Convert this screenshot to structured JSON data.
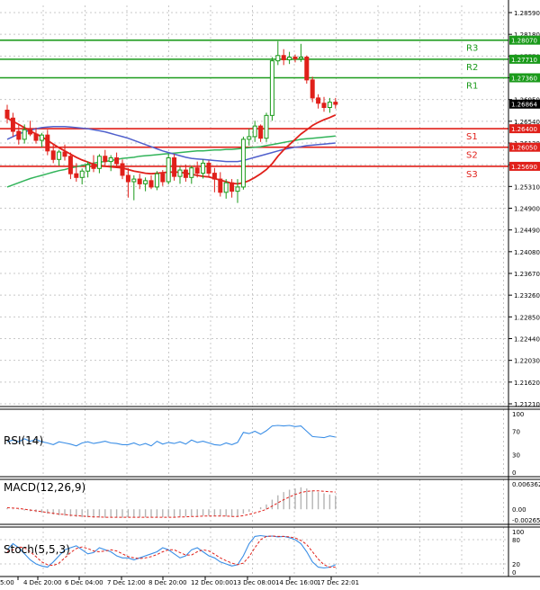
{
  "chart_data": {
    "type": "candlestick",
    "main": {
      "ylim": [
        1.19,
        1.2928
      ],
      "y_ticks": [
        "1.28590",
        "1.28180",
        "1.27770",
        "1.27360",
        "1.26950",
        "1.26540",
        "1.26130",
        "1.25720",
        "1.25310",
        "1.24900",
        "1.24490",
        "1.24080",
        "1.23670",
        "1.23260",
        "1.22850",
        "1.22440",
        "1.22030",
        "1.21620",
        "1.21210"
      ],
      "current_price": "1.26864",
      "levels": [
        {
          "name": "R3",
          "value": 1.2807,
          "label": "1.28070",
          "color": "#1a9a1a"
        },
        {
          "name": "R2",
          "value": 1.2771,
          "label": "1.27710",
          "color": "#1a9a1a"
        },
        {
          "name": "R1",
          "value": 1.2736,
          "label": "1.27360",
          "color": "#1a9a1a"
        },
        {
          "name": "S1",
          "value": 1.264,
          "label": "1.26400",
          "color": "#e0201a"
        },
        {
          "name": "S2",
          "value": 1.2605,
          "label": "1.26050",
          "color": "#e0201a"
        },
        {
          "name": "S3",
          "value": 1.2569,
          "label": "1.25690",
          "color": "#e0201a"
        }
      ],
      "candles": [
        [
          1.2675,
          1.2685,
          1.265,
          1.266
        ],
        [
          1.266,
          1.267,
          1.2625,
          1.2635
        ],
        [
          1.2635,
          1.2648,
          1.261,
          1.262
        ],
        [
          1.262,
          1.2648,
          1.2612,
          1.2638
        ],
        [
          1.2638,
          1.2655,
          1.2626,
          1.263
        ],
        [
          1.263,
          1.2642,
          1.2612,
          1.2618
        ],
        [
          1.2618,
          1.2632,
          1.2605,
          1.2628
        ],
        [
          1.2628,
          1.2638,
          1.259,
          1.2598
        ],
        [
          1.2598,
          1.2612,
          1.2575,
          1.2582
        ],
        [
          1.2582,
          1.26,
          1.257,
          1.2596
        ],
        [
          1.2596,
          1.261,
          1.258,
          1.2588
        ],
        [
          1.2588,
          1.2595,
          1.2545,
          1.2555
        ],
        [
          1.2555,
          1.2575,
          1.254,
          1.2548
        ],
        [
          1.2548,
          1.2565,
          1.2535,
          1.256
        ],
        [
          1.256,
          1.2578,
          1.2548,
          1.2572
        ],
        [
          1.2572,
          1.259,
          1.2558,
          1.2565
        ],
        [
          1.2565,
          1.2592,
          1.2556,
          1.2588
        ],
        [
          1.2588,
          1.26,
          1.257,
          1.2578
        ],
        [
          1.2578,
          1.259,
          1.256,
          1.2585
        ],
        [
          1.2585,
          1.2595,
          1.2566,
          1.2574
        ],
        [
          1.2574,
          1.2582,
          1.2545,
          1.2552
        ],
        [
          1.2552,
          1.2566,
          1.251,
          1.254
        ],
        [
          1.254,
          1.2552,
          1.2505,
          1.2545
        ],
        [
          1.2545,
          1.2555,
          1.2526,
          1.2536
        ],
        [
          1.2536,
          1.2548,
          1.2522,
          1.2542
        ],
        [
          1.2542,
          1.2552,
          1.2526,
          1.253
        ],
        [
          1.253,
          1.256,
          1.2524,
          1.2555
        ],
        [
          1.2555,
          1.2562,
          1.2532,
          1.254
        ],
        [
          1.254,
          1.2592,
          1.2535,
          1.2585
        ],
        [
          1.2585,
          1.2592,
          1.2542,
          1.255
        ],
        [
          1.255,
          1.2568,
          1.2536,
          1.2562
        ],
        [
          1.2562,
          1.2572,
          1.254,
          1.2548
        ],
        [
          1.2548,
          1.257,
          1.2536,
          1.2566
        ],
        [
          1.2566,
          1.2578,
          1.2548,
          1.2556
        ],
        [
          1.2556,
          1.2582,
          1.2546,
          1.2575
        ],
        [
          1.2575,
          1.258,
          1.255,
          1.2556
        ],
        [
          1.2556,
          1.2566,
          1.252,
          1.2545
        ],
        [
          1.2545,
          1.2558,
          1.2512,
          1.252
        ],
        [
          1.252,
          1.2545,
          1.2508,
          1.2538
        ],
        [
          1.2538,
          1.2545,
          1.251,
          1.2522
        ],
        [
          1.2522,
          1.2545,
          1.25,
          1.253
        ],
        [
          1.253,
          1.2625,
          1.2525,
          1.262
        ],
        [
          1.262,
          1.264,
          1.2608,
          1.2625
        ],
        [
          1.2625,
          1.2655,
          1.2615,
          1.2645
        ],
        [
          1.2645,
          1.2648,
          1.2615,
          1.2622
        ],
        [
          1.2622,
          1.267,
          1.2615,
          1.2665
        ],
        [
          1.2665,
          1.2775,
          1.2655,
          1.2768
        ],
        [
          1.2768,
          1.2805,
          1.276,
          1.2778
        ],
        [
          1.2778,
          1.279,
          1.276,
          1.277
        ],
        [
          1.277,
          1.2785,
          1.2762,
          1.2775
        ],
        [
          1.2775,
          1.278,
          1.2765,
          1.2772
        ],
        [
          1.2772,
          1.28,
          1.2766,
          1.2775
        ],
        [
          1.2775,
          1.2778,
          1.2725,
          1.2732
        ],
        [
          1.2732,
          1.2738,
          1.269,
          1.2698
        ],
        [
          1.2698,
          1.2705,
          1.2678,
          1.2688
        ],
        [
          1.2688,
          1.27,
          1.2672,
          1.268
        ],
        [
          1.268,
          1.2698,
          1.267,
          1.269
        ],
        [
          1.269,
          1.2698,
          1.2678,
          1.2686
        ]
      ],
      "ma_fast": [
        1.266,
        1.2654,
        1.2648,
        1.2642,
        1.2636,
        1.263,
        1.2625,
        1.2618,
        1.2611,
        1.2604,
        1.2598,
        1.2592,
        1.2586,
        1.2581,
        1.2577,
        1.2573,
        1.2571,
        1.2569,
        1.2568,
        1.2567,
        1.2566,
        1.2563,
        1.256,
        1.2558,
        1.2556,
        1.2555,
        1.2556,
        1.2557,
        1.2558,
        1.2558,
        1.2558,
        1.2556,
        1.2554,
        1.2552,
        1.255,
        1.2549,
        1.2546,
        1.2543,
        1.254,
        1.2537,
        1.2536,
        1.2538,
        1.2542,
        1.2548,
        1.2555,
        1.2563,
        1.2574,
        1.2588,
        1.26,
        1.261,
        1.262,
        1.263,
        1.2638,
        1.2646,
        1.2652,
        1.2657,
        1.2661,
        1.2666
      ],
      "ma_mid": [
        1.262,
        1.2625,
        1.263,
        1.2634,
        1.2637,
        1.264,
        1.2642,
        1.2643,
        1.2644,
        1.2644,
        1.2644,
        1.2643,
        1.2642,
        1.2641,
        1.264,
        1.2638,
        1.2636,
        1.2634,
        1.2631,
        1.2628,
        1.2625,
        1.2622,
        1.2618,
        1.2614,
        1.261,
        1.2606,
        1.2602,
        1.2598,
        1.2595,
        1.2592,
        1.2589,
        1.2586,
        1.2584,
        1.2583,
        1.2582,
        1.2581,
        1.258,
        1.2579,
        1.2578,
        1.2578,
        1.2578,
        1.258,
        1.2583,
        1.2586,
        1.2589,
        1.2592,
        1.2595,
        1.2598,
        1.2601,
        1.2603,
        1.2605,
        1.2606,
        1.2608,
        1.2609,
        1.261,
        1.2611,
        1.2612,
        1.2613
      ],
      "ma_slow": [
        1.253,
        1.2534,
        1.2538,
        1.2542,
        1.2546,
        1.2549,
        1.2552,
        1.2555,
        1.2558,
        1.2561,
        1.2563,
        1.2566,
        1.2568,
        1.2571,
        1.2573,
        1.2575,
        1.2577,
        1.2578,
        1.258,
        1.2582,
        1.2584,
        1.2585,
        1.2586,
        1.2588,
        1.2589,
        1.259,
        1.2591,
        1.2592,
        1.2593,
        1.2594,
        1.2595,
        1.2596,
        1.2597,
        1.2598,
        1.2598,
        1.2599,
        1.26,
        1.26,
        1.2601,
        1.2601,
        1.2602,
        1.2603,
        1.2604,
        1.2605,
        1.2606,
        1.2608,
        1.261,
        1.2612,
        1.2614,
        1.2616,
        1.2618,
        1.262,
        1.2621,
        1.2622,
        1.2623,
        1.2624,
        1.2625,
        1.2626
      ]
    },
    "rsi": {
      "title": "RSI(14)",
      "ticks": [
        "100",
        "70",
        "30",
        "0"
      ],
      "values": [
        52,
        55,
        52,
        57,
        53,
        56,
        52,
        50,
        47,
        52,
        50,
        48,
        45,
        50,
        52,
        49,
        51,
        53,
        50,
        49,
        47,
        47,
        50,
        46,
        49,
        45,
        53,
        48,
        51,
        49,
        52,
        48,
        55,
        51,
        53,
        50,
        47,
        46,
        50,
        47,
        51,
        68,
        66,
        70,
        65,
        71,
        79,
        80,
        79,
        80,
        78,
        79,
        70,
        61,
        60,
        59,
        62,
        60
      ]
    },
    "macd": {
      "title": "MACD(12,26,9)",
      "ticks": [
        "0.006362",
        "0.00",
        "-0.002652"
      ],
      "ylim": [
        -0.00265,
        0.00636
      ],
      "histogram": [
        0.0003,
        0.0001,
        -0.0001,
        -0.0003,
        -0.0005,
        -0.0007,
        -0.0009,
        -0.0011,
        -0.0013,
        -0.0015,
        -0.0016,
        -0.0018,
        -0.0019,
        -0.002,
        -0.002,
        -0.0021,
        -0.0021,
        -0.0021,
        -0.0021,
        -0.0021,
        -0.0021,
        -0.002,
        -0.002,
        -0.002,
        -0.002,
        -0.002,
        -0.002,
        -0.002,
        -0.0019,
        -0.0019,
        -0.0018,
        -0.0018,
        -0.0017,
        -0.0017,
        -0.0016,
        -0.0016,
        -0.0016,
        -0.0017,
        -0.0018,
        -0.0019,
        -0.0018,
        -0.0011,
        -0.0006,
        0.0,
        0.0005,
        0.0012,
        0.0024,
        0.0035,
        0.0043,
        0.0049,
        0.0052,
        0.0055,
        0.0052,
        0.0047,
        0.0043,
        0.004,
        0.0037,
        0.0034
      ],
      "signal": [
        0.0004,
        0.0003,
        0.0002,
        0.0,
        -0.0002,
        -0.0004,
        -0.0006,
        -0.0008,
        -0.001,
        -0.0012,
        -0.0013,
        -0.0015,
        -0.0016,
        -0.0017,
        -0.0018,
        -0.0019,
        -0.0019,
        -0.002,
        -0.002,
        -0.002,
        -0.002,
        -0.002,
        -0.002,
        -0.002,
        -0.002,
        -0.002,
        -0.002,
        -0.002,
        -0.002,
        -0.002,
        -0.0019,
        -0.0019,
        -0.0018,
        -0.0018,
        -0.0017,
        -0.0017,
        -0.0017,
        -0.0017,
        -0.0017,
        -0.0018,
        -0.0018,
        -0.0016,
        -0.0013,
        -0.0009,
        -0.0005,
        0.0,
        0.0008,
        0.0016,
        0.0024,
        0.0031,
        0.0037,
        0.0042,
        0.0045,
        0.0046,
        0.0046,
        0.0045,
        0.0044,
        0.0043
      ]
    },
    "stoch": {
      "title": "Stoch(5,5,3)",
      "ticks": [
        "100",
        "80",
        "20",
        "0"
      ],
      "main": [
        55,
        70,
        60,
        45,
        30,
        20,
        15,
        12,
        25,
        40,
        55,
        60,
        65,
        55,
        45,
        48,
        60,
        55,
        50,
        40,
        35,
        35,
        30,
        35,
        40,
        45,
        50,
        60,
        55,
        45,
        35,
        40,
        55,
        60,
        50,
        40,
        35,
        25,
        20,
        15,
        18,
        40,
        70,
        88,
        90,
        88,
        89,
        87,
        88,
        85,
        80,
        70,
        50,
        25,
        12,
        10,
        12,
        18
      ],
      "signal": [
        50,
        55,
        62,
        60,
        50,
        38,
        25,
        18,
        16,
        22,
        35,
        48,
        58,
        62,
        58,
        52,
        50,
        52,
        55,
        52,
        45,
        38,
        35,
        33,
        35,
        38,
        43,
        50,
        55,
        55,
        48,
        42,
        42,
        50,
        55,
        52,
        44,
        35,
        28,
        22,
        18,
        22,
        38,
        60,
        80,
        88,
        89,
        88,
        88,
        87,
        84,
        78,
        68,
        50,
        32,
        18,
        12,
        12
      ]
    },
    "x_ticks": [
      "5:00",
      "4 Dec 20:00",
      "6 Dec 04:00",
      "7 Dec 12:00",
      "8 Dec 20:00",
      "12 Dec 00:00",
      "13 Dec 08:00",
      "14 Dec 16:00",
      "17 Dec 22:01"
    ],
    "colors": {
      "bull": "#1a9a1a",
      "bear": "#e0201a",
      "ma_fast": "#e0201a",
      "ma_mid": "#5060cc",
      "ma_slow": "#32b45a",
      "rsi": "#3a8ee6",
      "stoch_main": "#3a8ee6",
      "stoch_signal": "#e0201a",
      "grid": "#c8c8c8",
      "axis": "#000000",
      "price_box": "#000000",
      "hist": "#b4b4b4"
    }
  }
}
